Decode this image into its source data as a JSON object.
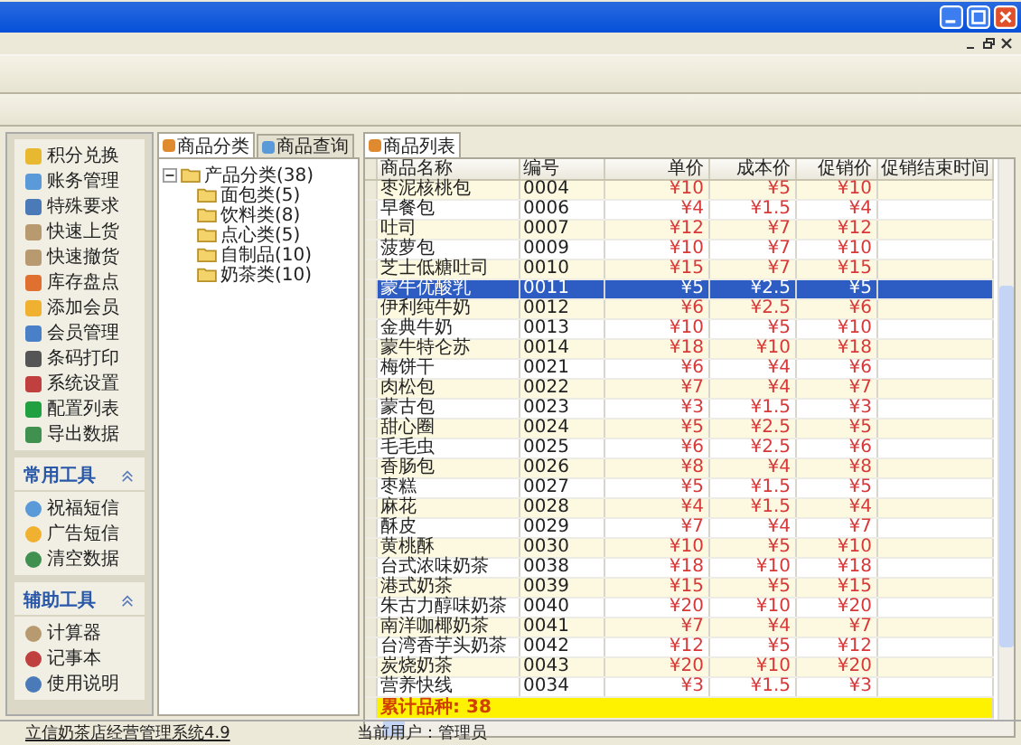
{
  "sidebar": {
    "items": [
      "积分兑换",
      "账务管理",
      "特殊要求",
      "快速上货",
      "快速撤货",
      "库存盘点",
      "添加会员",
      "会员管理",
      "条码打印",
      "系统设置",
      "配置列表",
      "导出数据"
    ],
    "groups": [
      {
        "title": "常用工具",
        "expanded": true,
        "items": [
          "祝福短信",
          "广告短信",
          "清空数据"
        ]
      },
      {
        "title": "辅助工具",
        "expanded": true,
        "items": [
          "计算器",
          "记事本",
          "使用说明"
        ]
      }
    ]
  },
  "left_tabs": [
    {
      "label": "商品分类",
      "selected": true
    },
    {
      "label": "商品查询",
      "selected": false
    }
  ],
  "tree": {
    "label": "产品分类(38)",
    "expanded": true,
    "children": [
      {
        "label": "面包类(5)"
      },
      {
        "label": "饮料类(8)"
      },
      {
        "label": "点心类(5)"
      },
      {
        "label": "自制品(10)"
      },
      {
        "label": "奶茶类(10)"
      }
    ]
  },
  "grid": {
    "tab": "商品列表",
    "columns": [
      "商品名称",
      "编号",
      "单价",
      "成本价",
      "促销价",
      "促销结束时间"
    ],
    "rows": [
      {
        "cells": [
          "枣泥核桃包",
          "0004",
          "¥10",
          "¥5",
          "¥10"
        ],
        "selected": false
      },
      {
        "cells": [
          "早餐包",
          "0006",
          "¥4",
          "¥1.5",
          "¥4"
        ],
        "selected": false
      },
      {
        "cells": [
          "吐司",
          "0007",
          "¥12",
          "¥7",
          "¥12"
        ],
        "selected": false
      },
      {
        "cells": [
          "菠萝包",
          "0009",
          "¥10",
          "¥7",
          "¥10"
        ],
        "selected": false
      },
      {
        "cells": [
          "芝士低糖吐司",
          "0010",
          "¥15",
          "¥7",
          "¥15"
        ],
        "selected": false
      },
      {
        "cells": [
          "蒙牛优酸乳",
          "0011",
          "¥5",
          "¥2.5",
          "¥5"
        ],
        "selected": true
      },
      {
        "cells": [
          "伊利纯牛奶",
          "0012",
          "¥6",
          "¥2.5",
          "¥6"
        ],
        "selected": false
      },
      {
        "cells": [
          "金典牛奶",
          "0013",
          "¥10",
          "¥5",
          "¥10"
        ],
        "selected": false
      },
      {
        "cells": [
          "蒙牛特仑苏",
          "0014",
          "¥18",
          "¥10",
          "¥18"
        ],
        "selected": false
      },
      {
        "cells": [
          "梅饼干",
          "0021",
          "¥6",
          "¥4",
          "¥6"
        ],
        "selected": false
      },
      {
        "cells": [
          "肉松包",
          "0022",
          "¥7",
          "¥4",
          "¥7"
        ],
        "selected": false
      },
      {
        "cells": [
          "蒙古包",
          "0023",
          "¥3",
          "¥1.5",
          "¥3"
        ],
        "selected": false
      },
      {
        "cells": [
          "甜心圈",
          "0024",
          "¥5",
          "¥2.5",
          "¥5"
        ],
        "selected": false
      },
      {
        "cells": [
          "毛毛虫",
          "0025",
          "¥6",
          "¥2.5",
          "¥6"
        ],
        "selected": false
      },
      {
        "cells": [
          "香肠包",
          "0026",
          "¥8",
          "¥4",
          "¥8"
        ],
        "selected": false
      },
      {
        "cells": [
          "枣糕",
          "0027",
          "¥5",
          "¥1.5",
          "¥5"
        ],
        "selected": false
      },
      {
        "cells": [
          "麻花",
          "0028",
          "¥4",
          "¥1.5",
          "¥4"
        ],
        "selected": false
      },
      {
        "cells": [
          "酥皮",
          "0029",
          "¥7",
          "¥4",
          "¥7"
        ],
        "selected": false
      },
      {
        "cells": [
          "黄桃酥",
          "0030",
          "¥10",
          "¥5",
          "¥10"
        ],
        "selected": false
      },
      {
        "cells": [
          "台式浓味奶茶",
          "0038",
          "¥18",
          "¥10",
          "¥18"
        ],
        "selected": false
      },
      {
        "cells": [
          "港式奶茶",
          "0039",
          "¥15",
          "¥5",
          "¥15"
        ],
        "selected": false
      },
      {
        "cells": [
          "朱古力醇味奶茶",
          "0040",
          "¥20",
          "¥10",
          "¥20"
        ],
        "selected": false
      },
      {
        "cells": [
          "南洋咖椰奶茶",
          "0041",
          "¥7",
          "¥4",
          "¥7"
        ],
        "selected": false
      },
      {
        "cells": [
          "台湾香芋头奶茶",
          "0042",
          "¥12",
          "¥5",
          "¥12"
        ],
        "selected": false
      },
      {
        "cells": [
          "炭烧奶茶",
          "0043",
          "¥20",
          "¥10",
          "¥20"
        ],
        "selected": false
      },
      {
        "cells": [
          "营养快线",
          "0034",
          "¥3",
          "¥1.5",
          "¥3"
        ],
        "selected": false
      }
    ],
    "total": "累计品种: 38"
  },
  "status_bar": [
    "立信奶茶店经营管理系统4.9",
    "当前用户：管理员"
  ]
}
